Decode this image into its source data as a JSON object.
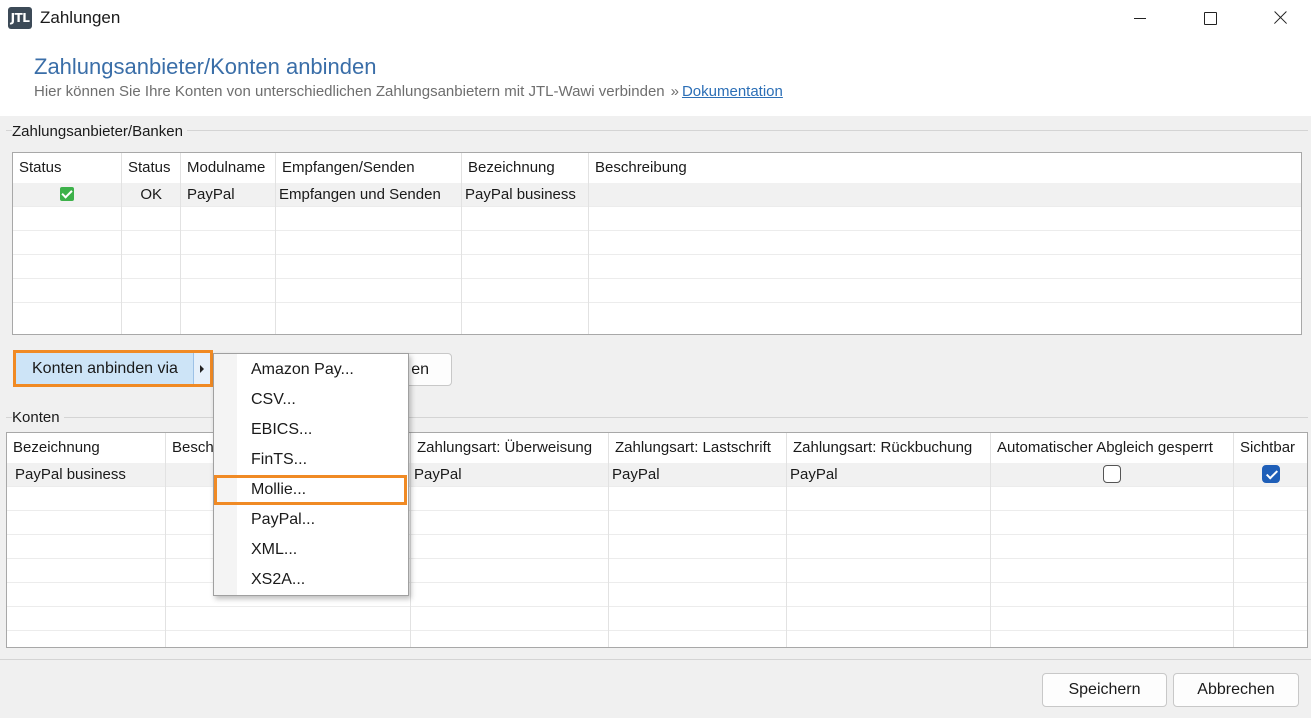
{
  "window": {
    "title": "Zahlungen",
    "logo_text": "JTL"
  },
  "header": {
    "title": "Zahlungsanbieter/Konten anbinden",
    "subtitle": "Hier können Sie Ihre Konten von unterschiedlichen Zahlungsanbietern mit JTL-Wawi verbinden",
    "separator": "»",
    "doc_link": "Dokumentation"
  },
  "providers": {
    "label": "Zahlungsanbieter/Banken",
    "columns": [
      "Status",
      "Status",
      "Modulname",
      "Empfangen/Senden",
      "Bezeichnung",
      "Beschreibung"
    ],
    "rows": [
      {
        "status_icon": "check-icon",
        "status": "OK",
        "module": "PayPal",
        "direction": "Empfangen und Senden",
        "name": "PayPal business",
        "description": ""
      }
    ]
  },
  "actions": {
    "connect_label": "Konten anbinden via",
    "hidden_button_fragment": "en"
  },
  "menu": {
    "items": [
      "Amazon Pay...",
      "CSV...",
      "EBICS...",
      "FinTS...",
      "Mollie...",
      "PayPal...",
      "XML...",
      "XS2A..."
    ],
    "highlighted": "Mollie..."
  },
  "accounts": {
    "label": "Konten",
    "columns": [
      "Bezeichnung",
      "Besch",
      "",
      "Zahlungsart: Überweisung",
      "Zahlungsart: Lastschrift",
      "Zahlungsart: Rückbuchung",
      "Automatischer Abgleich gesperrt",
      "Sichtbar"
    ],
    "rows": [
      {
        "name": "PayPal business",
        "transfer": "PayPal",
        "debit": "PayPal",
        "chargeback": "PayPal",
        "auto_lock": false,
        "visible": true
      }
    ]
  },
  "footer": {
    "save": "Speichern",
    "cancel": "Abbrechen"
  },
  "colors": {
    "accent_orange": "#f08a24",
    "title_blue": "#3a6ea8",
    "checkbox_blue": "#1f5fb8",
    "ok_green": "#3db14a"
  }
}
